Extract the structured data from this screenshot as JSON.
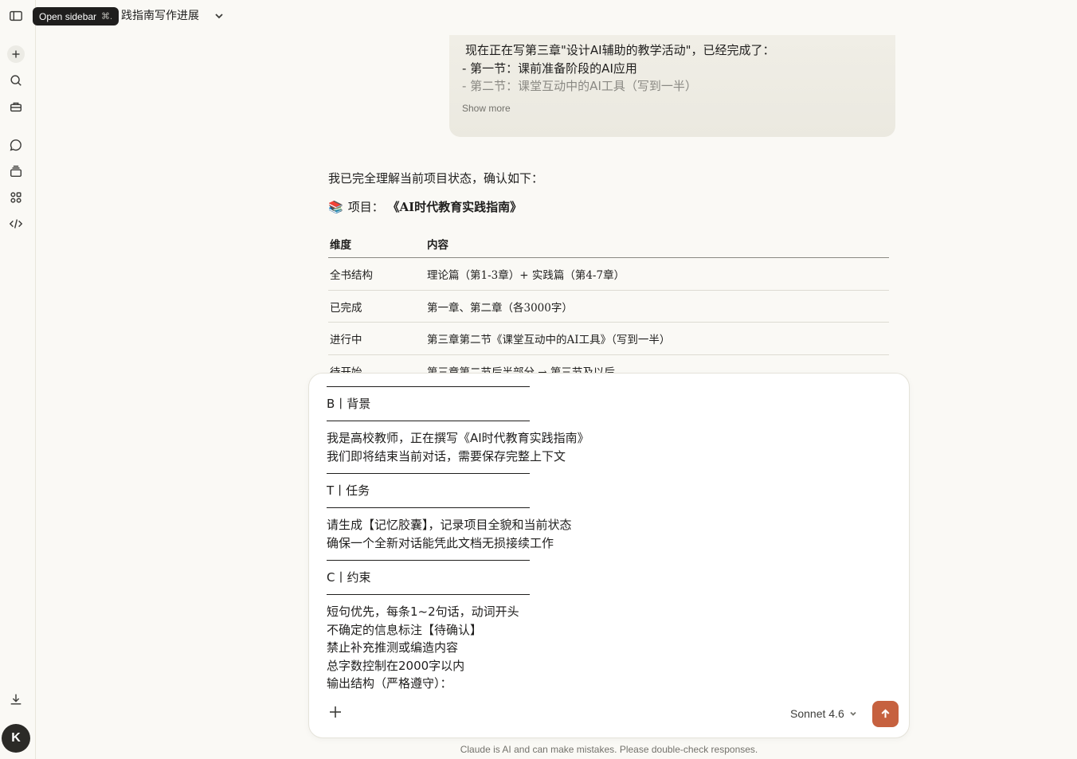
{
  "header": {
    "tooltip_label": "Open sidebar",
    "tooltip_shortcut": "⌘.",
    "chat_title": "践指南写作进展"
  },
  "user_message": {
    "lines": [
      "现在正在写第三章\"设计AI辅助的教学活动\"，已经完成了：",
      "- 第一节：课前准备阶段的AI应用",
      "- 第二节：课堂互动中的AI工具（写到一半）"
    ],
    "show_more": "Show more"
  },
  "assistant": {
    "intro": "我已完全理解当前项目状态，确认如下：",
    "project_emoji": "📚",
    "project_label": "项目：",
    "project_name": "《AI时代教育实践指南》",
    "table": {
      "headers": [
        "维度",
        "内容"
      ],
      "rows": [
        [
          "全书结构",
          "理论篇（第1-3章）+ 实践篇（第4-7章）"
        ],
        [
          "已完成",
          "第一章、第二章（各3000字）"
        ],
        [
          "进行中",
          "第三章第二节《课堂互动中的AI工具》（写到一半）"
        ],
        [
          "待开始",
          "第三章第二节后半部分 → 第三节及以后"
        ]
      ]
    }
  },
  "composer": {
    "section_b_title": "B丨背景",
    "section_b_lines": [
      "我是高校教师，正在撰写《AI时代教育实践指南》",
      "我们即将结束当前对话，需要保存完整上下文"
    ],
    "section_t_title": "T丨任务",
    "section_t_lines": [
      "请生成【记忆胶囊】，记录项目全貌和当前状态",
      "确保一个全新对话能凭此文档无损接续工作"
    ],
    "section_c_title": "C丨约束",
    "section_c_lines": [
      "短句优先，每条1~2句话，动词开头",
      "不确定的信息标注【待确认】",
      "禁止补充推测或编造内容",
      "总字数控制在2000字以内",
      "输出结构（严格遵守）："
    ],
    "model_name": "Sonnet 4.6"
  },
  "sidebar": {
    "avatar_initial": "K"
  },
  "footer": {
    "disclaimer": "Claude is AI and can make mistakes. Please double-check responses."
  },
  "colors": {
    "accent": "#c6613f",
    "background": "#faf9f5",
    "bubble": "#f0eee6"
  }
}
